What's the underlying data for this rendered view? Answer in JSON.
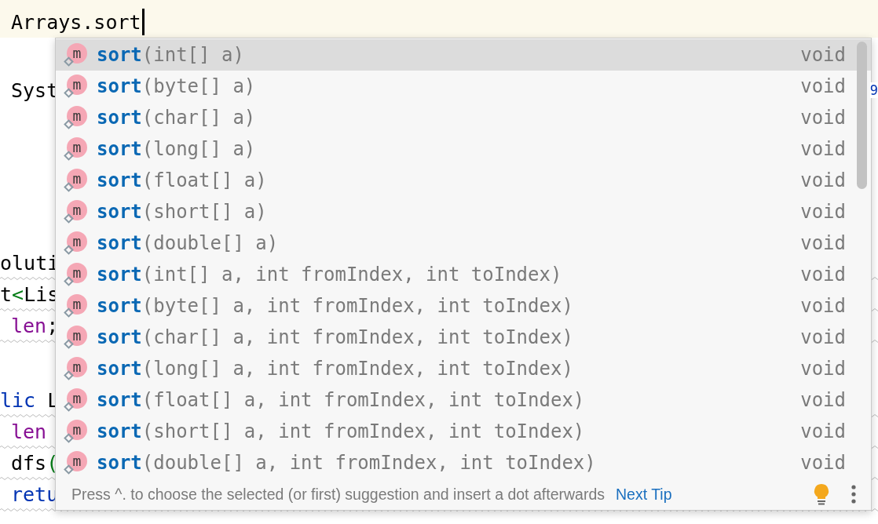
{
  "editor": {
    "lines": [
      {
        "current": true,
        "caret": true,
        "warning": false,
        "indent": true,
        "tokens": [
          {
            "text": "Arrays.sort",
            "kind": "plain"
          }
        ]
      },
      {
        "current": false,
        "warning": false,
        "indent": true,
        "tokens": [
          {
            "text": "Syst",
            "kind": "plain"
          }
        ],
        "right_tokens": [
          {
            "text": "9",
            "kind": "keyword"
          }
        ]
      },
      {
        "current": false,
        "warning": true,
        "indent": false,
        "tokens": [
          {
            "text": "oluti",
            "kind": "plain"
          }
        ]
      },
      {
        "current": false,
        "warning": true,
        "indent": false,
        "tokens": [
          {
            "text": "t",
            "kind": "plain"
          },
          {
            "text": "<",
            "kind": "bracket"
          },
          {
            "text": "Lis",
            "kind": "plain"
          }
        ]
      },
      {
        "current": false,
        "warning": true,
        "indent": true,
        "tokens": [
          {
            "text": "len",
            "kind": "field"
          },
          {
            "text": ";",
            "kind": "plain"
          }
        ]
      },
      {
        "current": false,
        "warning": true,
        "indent": false,
        "tokens": [
          {
            "text": "lic",
            "kind": "keyword"
          },
          {
            "text": " L",
            "kind": "plain"
          }
        ]
      },
      {
        "current": false,
        "warning": true,
        "indent": true,
        "tokens": [
          {
            "text": "len",
            "kind": "field"
          }
        ]
      },
      {
        "current": false,
        "warning": true,
        "indent": true,
        "tokens": [
          {
            "text": "dfs",
            "kind": "plain"
          },
          {
            "text": "(",
            "kind": "bracket"
          }
        ]
      },
      {
        "current": false,
        "warning": true,
        "indent": true,
        "tokens": [
          {
            "text": "retu",
            "kind": "keyword"
          }
        ]
      }
    ]
  },
  "completion": {
    "items": [
      {
        "icon_letter": "m",
        "name": "sort",
        "params": "(int[] a)",
        "type": "void",
        "selected": true
      },
      {
        "icon_letter": "m",
        "name": "sort",
        "params": "(byte[] a)",
        "type": "void",
        "selected": false
      },
      {
        "icon_letter": "m",
        "name": "sort",
        "params": "(char[] a)",
        "type": "void",
        "selected": false
      },
      {
        "icon_letter": "m",
        "name": "sort",
        "params": "(long[] a)",
        "type": "void",
        "selected": false
      },
      {
        "icon_letter": "m",
        "name": "sort",
        "params": "(float[] a)",
        "type": "void",
        "selected": false
      },
      {
        "icon_letter": "m",
        "name": "sort",
        "params": "(short[] a)",
        "type": "void",
        "selected": false
      },
      {
        "icon_letter": "m",
        "name": "sort",
        "params": "(double[] a)",
        "type": "void",
        "selected": false
      },
      {
        "icon_letter": "m",
        "name": "sort",
        "params": "(int[] a, int fromIndex, int toIndex)",
        "type": "void",
        "selected": false
      },
      {
        "icon_letter": "m",
        "name": "sort",
        "params": "(byte[] a, int fromIndex, int toIndex)",
        "type": "void",
        "selected": false
      },
      {
        "icon_letter": "m",
        "name": "sort",
        "params": "(char[] a, int fromIndex, int toIndex)",
        "type": "void",
        "selected": false
      },
      {
        "icon_letter": "m",
        "name": "sort",
        "params": "(long[] a, int fromIndex, int toIndex)",
        "type": "void",
        "selected": false
      },
      {
        "icon_letter": "m",
        "name": "sort",
        "params": "(float[] a, int fromIndex, int toIndex)",
        "type": "void",
        "selected": false
      },
      {
        "icon_letter": "m",
        "name": "sort",
        "params": "(short[] a, int fromIndex, int toIndex)",
        "type": "void",
        "selected": false
      },
      {
        "icon_letter": "m",
        "name": "sort",
        "params": "(double[] a, int fromIndex, int toIndex)",
        "type": "void",
        "selected": false
      }
    ],
    "footer": {
      "hint": "Press ^. to choose the selected (or first) suggestion and insert a dot afterwards",
      "link": "Next Tip"
    }
  }
}
